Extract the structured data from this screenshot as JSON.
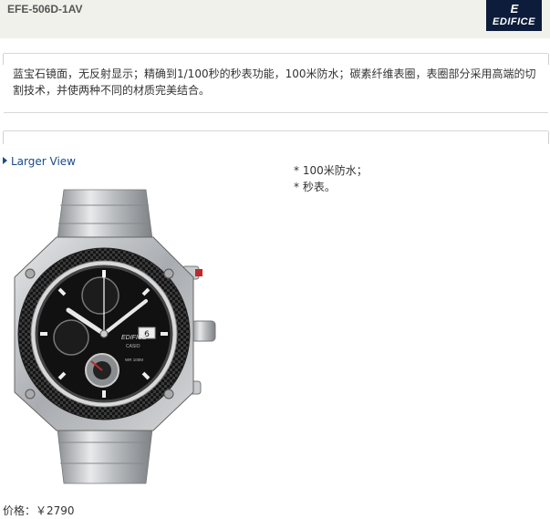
{
  "header": {
    "model": "EFE-506D-1AV",
    "logo_text": "EDIFICE",
    "logo_bg": "#0d1c3a"
  },
  "description": "蓝宝石镜面，无反射显示；精确到1/100秒的秒表功能，100米防水；碳素纤维表圈，表圈部分采用高端的切割技术，并使两种不同的材质完美结合。",
  "larger_view": {
    "label": "Larger View",
    "color": "#1a4a8a"
  },
  "features": [
    "100米防水；",
    "秒表。"
  ],
  "price": {
    "label": "价格：",
    "value": "￥2790"
  },
  "watch_dial": {
    "brand": "EDIFICE",
    "sub": "CASIO",
    "water": "WR 100M"
  }
}
